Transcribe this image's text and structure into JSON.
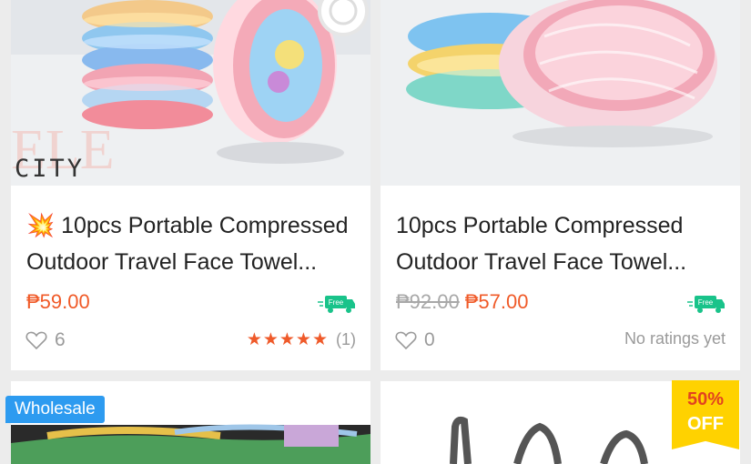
{
  "products": [
    {
      "emoji": "💥",
      "title": "10pcs Portable Compressed Outdoor Travel Face Towel...",
      "price": "₱59.00",
      "old_price": "",
      "shipping_badge": "Free",
      "likes": "6",
      "stars": "★★★★★",
      "rating_count": "(1)",
      "watermark": "CITY"
    },
    {
      "emoji": "",
      "title": "10pcs Portable Compressed Outdoor Travel Face Towel...",
      "price": "₱57.00",
      "old_price": "₱92.00",
      "shipping_badge": "Free",
      "likes": "0",
      "rating_text": "No ratings yet"
    }
  ],
  "lower_badges": {
    "wholesale": "Wholesale",
    "discount_percent": "50%",
    "discount_off": "OFF"
  },
  "colors": {
    "price": "#f05a28",
    "free_shipping": "#19c38a",
    "wholesale": "#2d9bf0",
    "discount": "#ffd200"
  }
}
